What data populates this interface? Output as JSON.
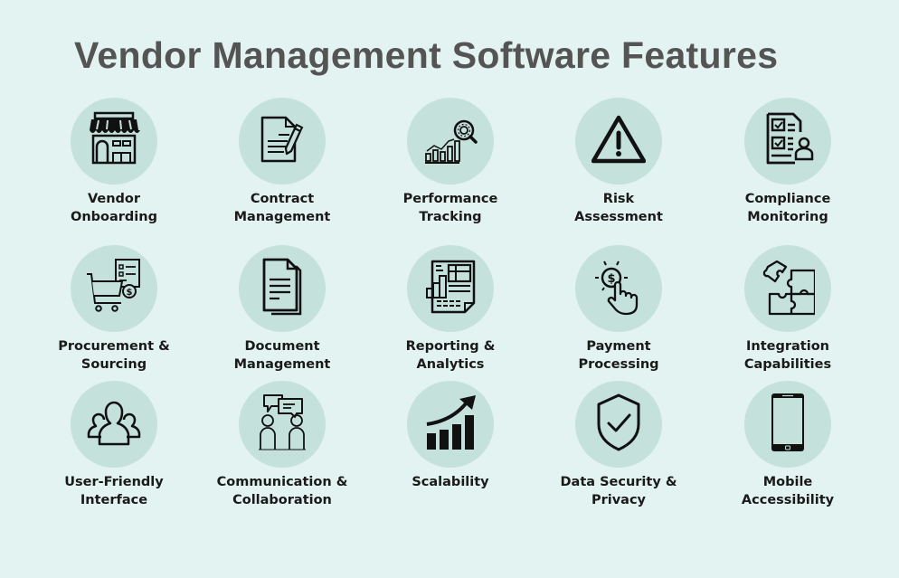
{
  "title": "Vendor Management Software Features",
  "colors": {
    "background": "#e3f3f1",
    "circle": "#c5e1dc",
    "title": "#545454",
    "label": "#1a1a1a",
    "icon": "#111111"
  },
  "features": [
    {
      "line1": "Vendor",
      "line2": "Onboarding",
      "icon": "storefront-icon"
    },
    {
      "line1": "Contract",
      "line2": "Management",
      "icon": "contract-pen-icon"
    },
    {
      "line1": "Performance",
      "line2": "Tracking",
      "icon": "chart-magnifier-icon"
    },
    {
      "line1": "Risk",
      "line2": "Assessment",
      "icon": "warning-triangle-icon"
    },
    {
      "line1": "Compliance",
      "line2": "Monitoring",
      "icon": "checklist-user-icon"
    },
    {
      "line1": "Procurement &",
      "line2": "Sourcing",
      "icon": "cart-invoice-icon"
    },
    {
      "line1": "Document",
      "line2": "Management",
      "icon": "documents-icon"
    },
    {
      "line1": "Reporting &",
      "line2": "Analytics",
      "icon": "report-icon"
    },
    {
      "line1": "Payment",
      "line2": "Processing",
      "icon": "coin-tap-icon"
    },
    {
      "line1": "Integration",
      "line2": "Capabilities",
      "icon": "puzzle-icon"
    },
    {
      "line1": "User-Friendly",
      "line2": "Interface",
      "icon": "users-icon"
    },
    {
      "line1": "Communication &",
      "line2": "Collaboration",
      "icon": "chat-people-icon"
    },
    {
      "line1": "Scalability",
      "line2": "",
      "icon": "growth-chart-icon"
    },
    {
      "line1": "Data Security &",
      "line2": "Privacy",
      "icon": "shield-check-icon"
    },
    {
      "line1": "Mobile",
      "line2": "Accessibility",
      "icon": "smartphone-icon"
    }
  ]
}
